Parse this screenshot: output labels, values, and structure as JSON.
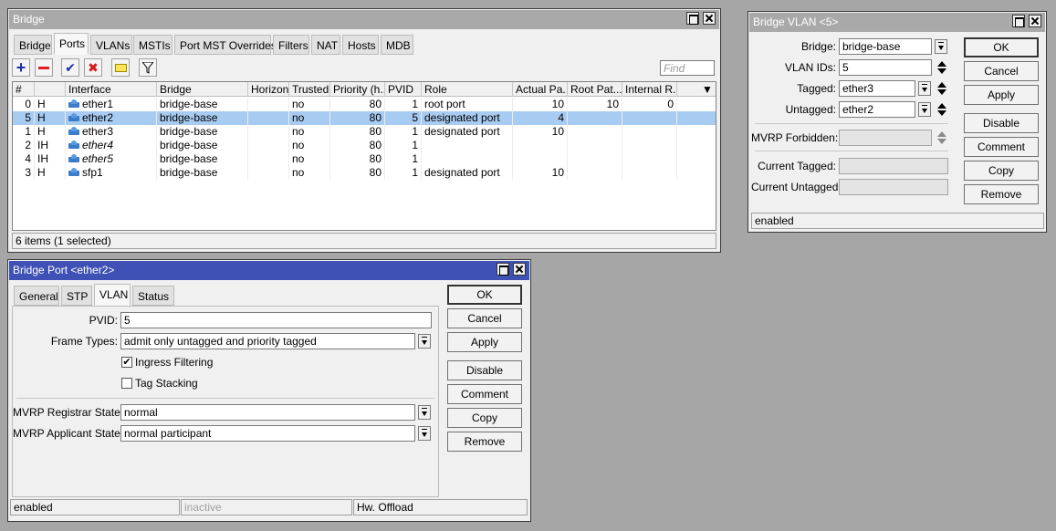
{
  "bridge": {
    "title": "Bridge",
    "tabs": [
      "Bridge",
      "Ports",
      "VLANs",
      "MSTIs",
      "Port MST Overrides",
      "Filters",
      "NAT",
      "Hosts",
      "MDB"
    ],
    "selected_tab": "Ports",
    "find_placeholder": "Find",
    "columns": [
      "#",
      "",
      "Interface",
      "Bridge",
      "Horizon",
      "Trusted",
      "Priority (h...",
      "PVID",
      "Role",
      "Actual Pa...",
      "Root Pat...",
      "Internal R..."
    ],
    "rows": [
      {
        "num": "0",
        "flags": "H",
        "interface": "ether1",
        "italic": false,
        "bridge": "bridge-base",
        "horizon": "",
        "trusted": "no",
        "priority": "80",
        "pvid": "1",
        "role": "root port",
        "actual": "10",
        "root": "10",
        "internal": "0",
        "selected": false
      },
      {
        "num": "5",
        "flags": "H",
        "interface": "ether2",
        "italic": false,
        "bridge": "bridge-base",
        "horizon": "",
        "trusted": "no",
        "priority": "80",
        "pvid": "5",
        "role": "designated port",
        "actual": "4",
        "root": "",
        "internal": "",
        "selected": true
      },
      {
        "num": "1",
        "flags": "H",
        "interface": "ether3",
        "italic": false,
        "bridge": "bridge-base",
        "horizon": "",
        "trusted": "no",
        "priority": "80",
        "pvid": "1",
        "role": "designated port",
        "actual": "10",
        "root": "",
        "internal": "",
        "selected": false
      },
      {
        "num": "2",
        "flags": "IH",
        "interface": "ether4",
        "italic": true,
        "bridge": "bridge-base",
        "horizon": "",
        "trusted": "no",
        "priority": "80",
        "pvid": "1",
        "role": "",
        "actual": "",
        "root": "",
        "internal": "",
        "selected": false
      },
      {
        "num": "4",
        "flags": "IH",
        "interface": "ether5",
        "italic": true,
        "bridge": "bridge-base",
        "horizon": "",
        "trusted": "no",
        "priority": "80",
        "pvid": "1",
        "role": "",
        "actual": "",
        "root": "",
        "internal": "",
        "selected": false
      },
      {
        "num": "3",
        "flags": "H",
        "interface": "sfp1",
        "italic": false,
        "bridge": "bridge-base",
        "horizon": "",
        "trusted": "no",
        "priority": "80",
        "pvid": "1",
        "role": "designated port",
        "actual": "10",
        "root": "",
        "internal": "",
        "selected": false
      }
    ],
    "status": "6 items (1 selected)"
  },
  "vlan": {
    "title": "Bridge VLAN <5>",
    "bridge_label": "Bridge:",
    "bridge_value": "bridge-base",
    "vlan_ids_label": "VLAN IDs:",
    "vlan_ids_value": "5",
    "tagged_label": "Tagged:",
    "tagged_value": "ether3",
    "untagged_label": "Untagged:",
    "untagged_value": "ether2",
    "mvrp_label": "MVRP Forbidden:",
    "current_tagged_label": "Current Tagged:",
    "current_untagged_label": "Current Untagged:",
    "buttons": [
      "OK",
      "Cancel",
      "Apply",
      "Disable",
      "Comment",
      "Copy",
      "Remove"
    ],
    "status": "enabled"
  },
  "port": {
    "title": "Bridge Port <ether2>",
    "tabs": [
      "General",
      "STP",
      "VLAN",
      "Status"
    ],
    "selected_tab": "VLAN",
    "pvid_label": "PVID:",
    "pvid_value": "5",
    "frame_types_label": "Frame Types:",
    "frame_types_value": "admit only untagged and priority tagged",
    "ingress_filtering_label": "Ingress Filtering",
    "ingress_filtering_checked": true,
    "tag_stacking_label": "Tag Stacking",
    "tag_stacking_checked": false,
    "registrar_label": "MVRP Registrar State:",
    "registrar_value": "normal",
    "applicant_label": "MVRP Applicant State:",
    "applicant_value": "normal participant",
    "buttons": [
      "OK",
      "Cancel",
      "Apply",
      "Disable",
      "Comment",
      "Copy",
      "Remove"
    ],
    "status_enabled": "enabled",
    "status_inactive": "inactive",
    "status_offload": "Hw. Offload"
  }
}
